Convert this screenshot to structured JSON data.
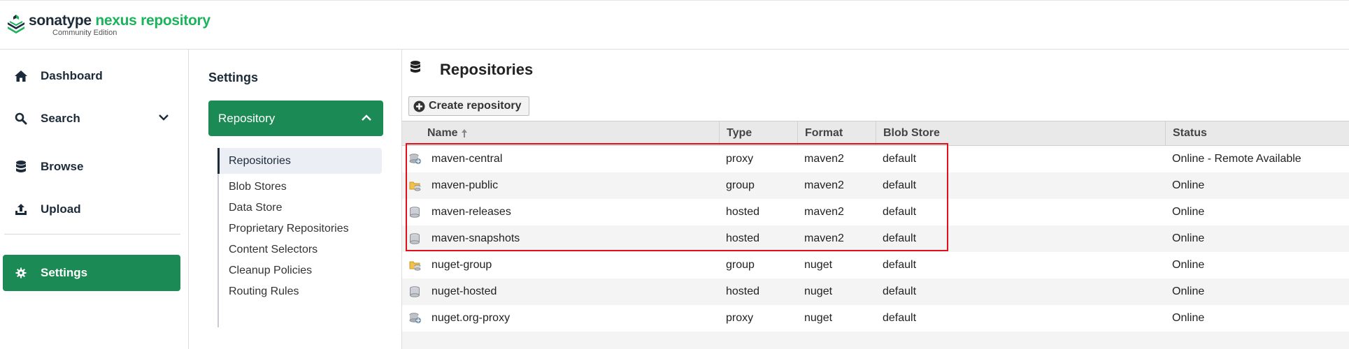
{
  "brand": {
    "sonatype": "sonatype",
    "product": "nexus repository",
    "edition": "Community Edition"
  },
  "nav": {
    "items": [
      {
        "label": "Dashboard",
        "icon": "home-icon"
      },
      {
        "label": "Search",
        "icon": "search-icon"
      },
      {
        "label": "Browse",
        "icon": "database-icon"
      },
      {
        "label": "Upload",
        "icon": "upload-icon"
      },
      {
        "label": "Settings",
        "icon": "gear-icon"
      }
    ]
  },
  "settings": {
    "title": "Settings",
    "group": "Repository",
    "items": [
      "Repositories",
      "Blob Stores",
      "Data Store",
      "Proprietary Repositories",
      "Content Selectors",
      "Cleanup Policies",
      "Routing Rules"
    ]
  },
  "main": {
    "title": "Repositories",
    "create_label": "Create repository",
    "columns": {
      "name": "Name",
      "type": "Type",
      "format": "Format",
      "blob": "Blob Store",
      "status": "Status"
    },
    "rows": [
      {
        "name": "maven-central",
        "type": "proxy",
        "format": "maven2",
        "blob": "default",
        "status": "Online - Remote Available"
      },
      {
        "name": "maven-public",
        "type": "group",
        "format": "maven2",
        "blob": "default",
        "status": "Online"
      },
      {
        "name": "maven-releases",
        "type": "hosted",
        "format": "maven2",
        "blob": "default",
        "status": "Online"
      },
      {
        "name": "maven-snapshots",
        "type": "hosted",
        "format": "maven2",
        "blob": "default",
        "status": "Online"
      },
      {
        "name": "nuget-group",
        "type": "group",
        "format": "nuget",
        "blob": "default",
        "status": "Online"
      },
      {
        "name": "nuget-hosted",
        "type": "hosted",
        "format": "nuget",
        "blob": "default",
        "status": "Online"
      },
      {
        "name": "nuget.org-proxy",
        "type": "proxy",
        "format": "nuget",
        "blob": "default",
        "status": "Online"
      }
    ]
  },
  "colors": {
    "accent": "#1c8a55",
    "brand_green": "#1bb35b",
    "highlight": "#e0111b"
  }
}
